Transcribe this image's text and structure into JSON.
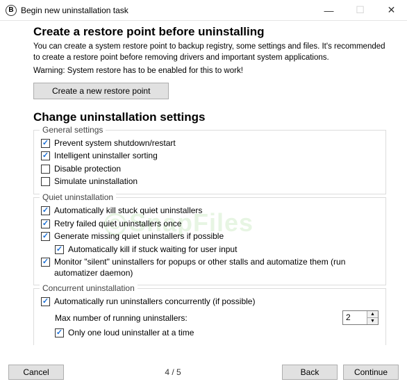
{
  "titlebar": {
    "title": "Begin new uninstallation task"
  },
  "section1": {
    "heading": "Create a restore point before uninstalling",
    "desc": "You can create a system restore point to backup registry, some settings and files. It's recommended to create a restore point before removing drivers and important system applications.",
    "warning": "Warning: System restore has to be enabled for this to work!",
    "button": "Create a new restore point"
  },
  "section2": {
    "heading": "Change uninstallation settings"
  },
  "groups": {
    "general": {
      "title": "General settings",
      "opts": [
        {
          "label": "Prevent system shutdown/restart",
          "checked": true
        },
        {
          "label": "Intelligent uninstaller sorting",
          "checked": true
        },
        {
          "label": "Disable protection",
          "checked": false
        },
        {
          "label": "Simulate uninstallation",
          "checked": false
        }
      ]
    },
    "quiet": {
      "title": "Quiet uninstallation",
      "opts": [
        {
          "label": "Automatically kill stuck quiet uninstallers",
          "checked": true
        },
        {
          "label": "Retry failed quiet uninstallers once",
          "checked": true
        },
        {
          "label": "Generate missing quiet uninstallers if possible",
          "checked": true
        },
        {
          "label": "Automatically kill if stuck waiting for user input",
          "checked": true,
          "indent": true
        },
        {
          "label": "Monitor \"silent\" uninstallers for popups or other stalls and automatize them (run automatizer daemon)",
          "checked": true
        }
      ]
    },
    "concurrent": {
      "title": "Concurrent uninstallation",
      "opt_auto": {
        "label": "Automatically run uninstallers concurrently (if possible)",
        "checked": true
      },
      "max_label": "Max number of running uninstallers:",
      "max_value": "2",
      "opt_one_loud": {
        "label": "Only one loud uninstaller at a time",
        "checked": true
      }
    }
  },
  "footer": {
    "cancel": "Cancel",
    "page": "4 / 5",
    "back": "Back",
    "continue": "Continue"
  },
  "watermark": "SnapFiles"
}
